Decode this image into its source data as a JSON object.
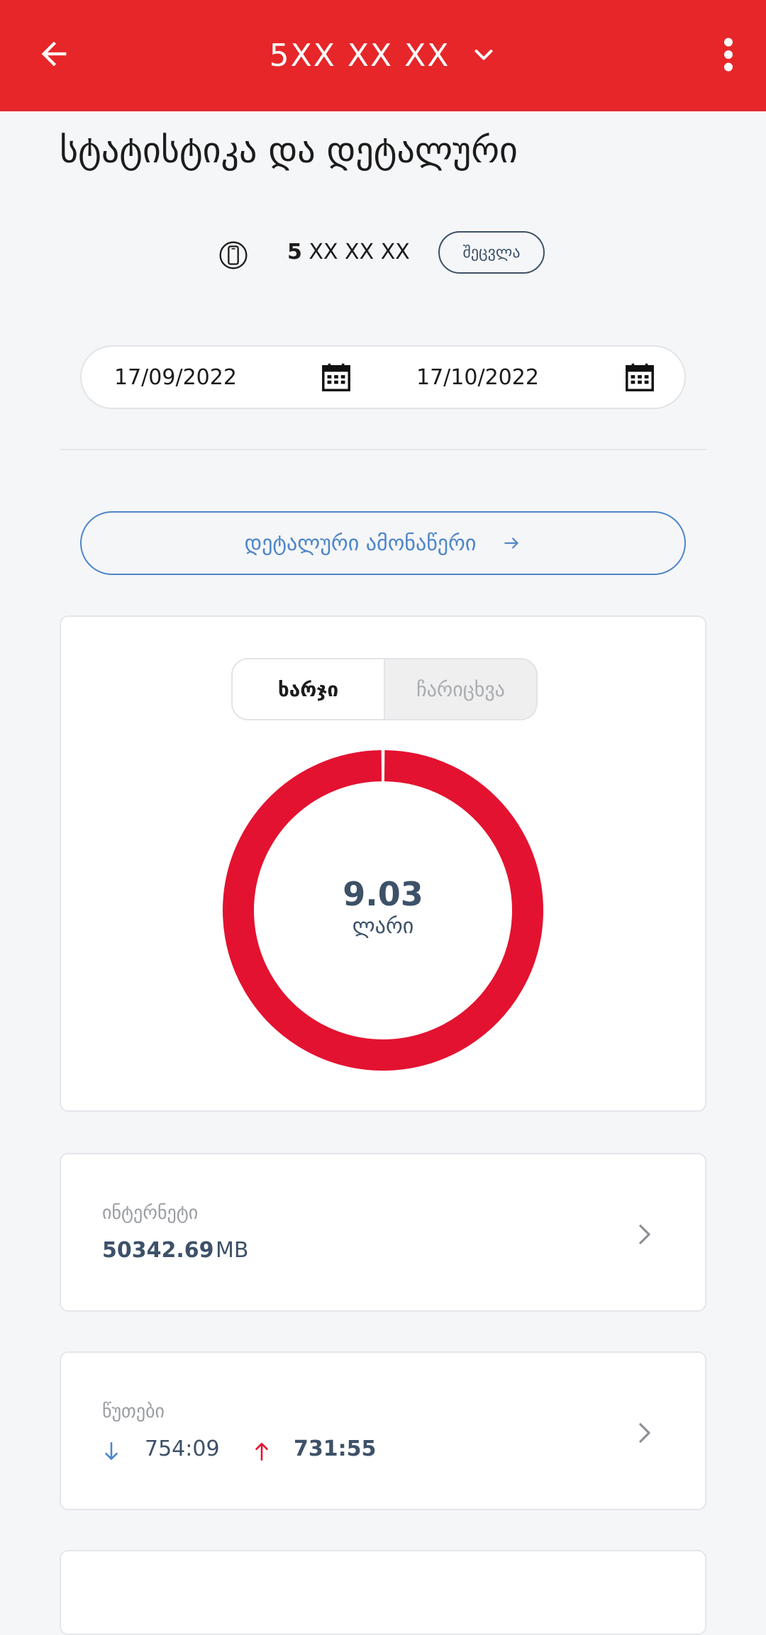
{
  "appbar": {
    "title": "5XX XX XX",
    "bg_color": "#e62629",
    "icons": [
      "arrow-left-icon",
      "chevron-down-icon",
      "more-vertical-icon"
    ]
  },
  "page": {
    "title": "სტატისტიკა და დეტალური"
  },
  "number": {
    "prefix": "5",
    "rest": " XX XX XX",
    "change_label": "შეცვლა",
    "icon": "phone-icon"
  },
  "dates": {
    "from": "17/09/2022",
    "to": "17/10/2022",
    "icon": "calendar-icon"
  },
  "detail_button": {
    "label": "დეტალური ამონაწერი",
    "color": "#4e86c9"
  },
  "tabs": {
    "active": "ხარჯი",
    "inactive": "ჩარიცხვა"
  },
  "chart_data": {
    "type": "pie",
    "categories": [
      ""
    ],
    "values": [
      9.03
    ],
    "center_value": "9.03",
    "center_unit": "ლარი",
    "color": "#e31230"
  },
  "internet": {
    "label": "ინტერნეტი",
    "value": "50342.69",
    "unit": "MB"
  },
  "minutes": {
    "label": "წუთები",
    "incoming": "754:09",
    "outgoing": "731:55",
    "incoming_color": "#4e86c9",
    "outgoing_color": "#e31230"
  }
}
